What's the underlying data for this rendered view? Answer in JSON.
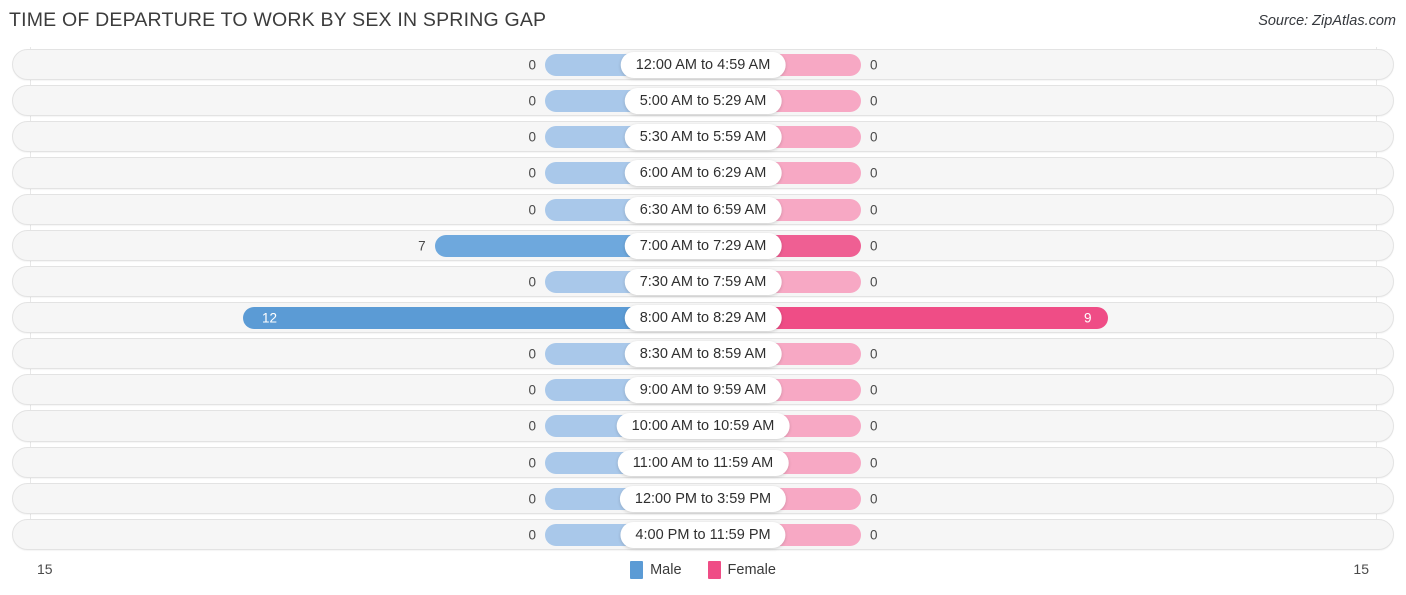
{
  "header": {
    "title": "TIME OF DEPARTURE TO WORK BY SEX IN SPRING GAP",
    "source": "Source: ZipAtlas.com"
  },
  "legend": {
    "male_label": "Male",
    "female_label": "Female",
    "male_color": "#5b9bd5",
    "female_color": "#ef4d86"
  },
  "axis": {
    "left_max": "15",
    "right_max": "15"
  },
  "chart_data": {
    "type": "bar",
    "title": "TIME OF DEPARTURE TO WORK BY SEX IN SPRING GAP",
    "subtitle": "",
    "orientation": "horizontal-diverging",
    "xlabel": "",
    "ylabel": "",
    "xlim": [
      15,
      15
    ],
    "grid": false,
    "legend_position": "bottom-center",
    "categories": [
      "12:00 AM to 4:59 AM",
      "5:00 AM to 5:29 AM",
      "5:30 AM to 5:59 AM",
      "6:00 AM to 6:29 AM",
      "6:30 AM to 6:59 AM",
      "7:00 AM to 7:29 AM",
      "7:30 AM to 7:59 AM",
      "8:00 AM to 8:29 AM",
      "8:30 AM to 8:59 AM",
      "9:00 AM to 9:59 AM",
      "10:00 AM to 10:59 AM",
      "11:00 AM to 11:59 AM",
      "12:00 PM to 3:59 PM",
      "4:00 PM to 11:59 PM"
    ],
    "series": [
      {
        "name": "Male",
        "color": "#5b9bd5",
        "values": [
          0,
          0,
          0,
          0,
          0,
          7,
          0,
          12,
          0,
          0,
          0,
          0,
          0,
          0
        ],
        "labels": [
          "0",
          "0",
          "0",
          "0",
          "0",
          "7",
          "0",
          "12",
          "0",
          "0",
          "0",
          "0",
          "0",
          "0"
        ]
      },
      {
        "name": "Female",
        "color": "#ef4d86",
        "values": [
          0,
          0,
          0,
          0,
          0,
          0,
          0,
          9,
          0,
          0,
          0,
          0,
          0,
          0
        ],
        "labels": [
          "0",
          "0",
          "0",
          "0",
          "0",
          "0",
          "0",
          "9",
          "0",
          "0",
          "0",
          "0",
          "0",
          "0"
        ]
      }
    ]
  }
}
